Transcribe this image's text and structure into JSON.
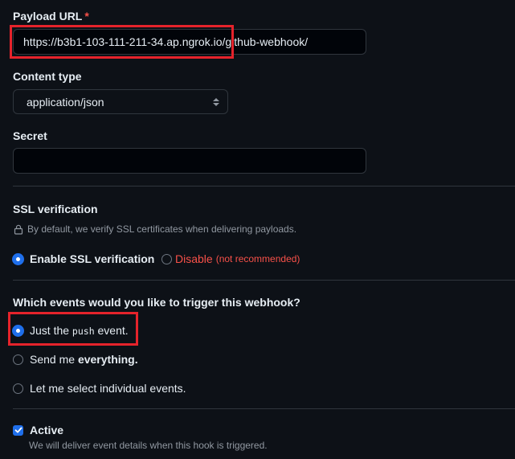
{
  "payload_url": {
    "label": "Payload URL",
    "required_mark": "*",
    "value": "https://b3b1-103-111-211-34.ap.ngrok.io/github-webhook/"
  },
  "content_type": {
    "label": "Content type",
    "selected": "application/json"
  },
  "secret": {
    "label": "Secret",
    "value": ""
  },
  "ssl": {
    "label": "SSL verification",
    "description": "By default, we verify SSL certificates when delivering payloads.",
    "enable_label": "Enable SSL verification",
    "disable_label": "Disable",
    "disable_note": "(not recommended)"
  },
  "events": {
    "question": "Which events would you like to trigger this webhook?",
    "just_push_prefix": "Just the",
    "just_push_code": "push",
    "just_push_suffix": "event.",
    "everything_prefix": "Send me",
    "everything_bold": "everything.",
    "individual_label": "Let me select individual events."
  },
  "active": {
    "label": "Active",
    "description": "We will deliver event details when this hook is triggered."
  },
  "colors": {
    "background": "#0d1117",
    "accent": "#1f6feb",
    "danger": "#f85149",
    "highlight": "#e5232b"
  }
}
